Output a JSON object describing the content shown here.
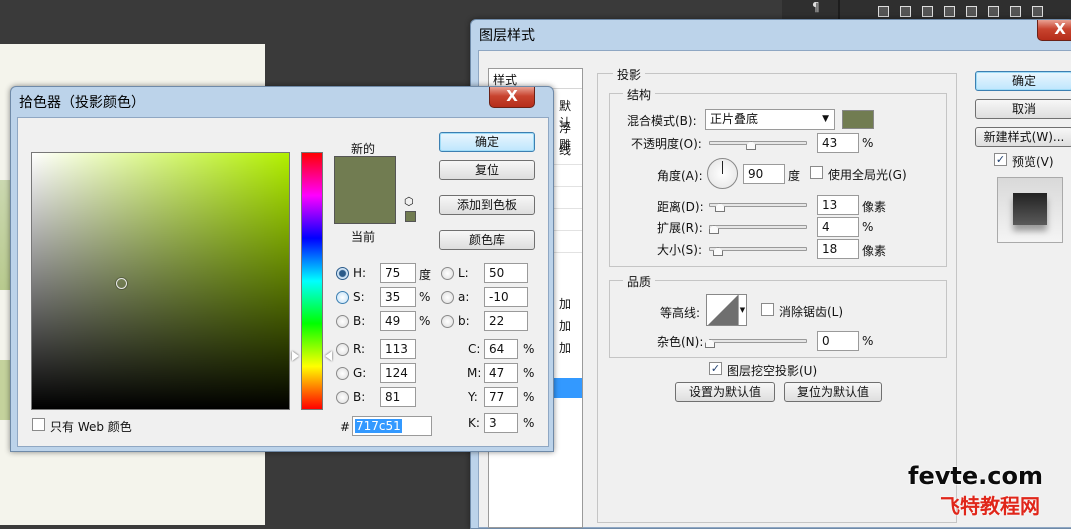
{
  "layer_style": {
    "title": "图层样式",
    "close": "X",
    "styles_header": "样式",
    "styles_partial": [
      "默认",
      "浮雕",
      "线"
    ],
    "styles_partial_lower": [
      "加",
      "加",
      "加"
    ],
    "section_title": "投影",
    "structure": {
      "title": "结构",
      "blend_mode_label": "混合模式(B):",
      "blend_mode_value": "正片叠底",
      "blend_color": "#717c51",
      "opacity_label": "不透明度(O):",
      "opacity_value": "43",
      "opacity_unit": "%",
      "opacity_level": 0.43,
      "angle_label": "角度(A):",
      "angle_value": "90",
      "angle_unit": "度",
      "global_light_label": "使用全局光(G)",
      "global_light_checked": false,
      "distance_label": "距离(D):",
      "distance_value": "13",
      "distance_unit": "像素",
      "spread_label": "扩展(R):",
      "spread_value": "4",
      "spread_unit": "%",
      "size_label": "大小(S):",
      "size_value": "18",
      "size_unit": "像素"
    },
    "quality": {
      "title": "品质",
      "contour_label": "等高线:",
      "antialias_label": "消除锯齿(L)",
      "noise_label": "杂色(N):",
      "noise_value": "0",
      "noise_unit": "%"
    },
    "knockout_label": "图层挖空投影(U)",
    "knockout_checked": true,
    "make_default": "设置为默认值",
    "reset_default": "复位为默认值",
    "ok": "确定",
    "cancel": "取消",
    "new_style": "新建样式(W)...",
    "preview_label": "预览(V)",
    "preview_checked": true
  },
  "color_picker": {
    "title": "拾色器（投影颜色）",
    "close": "X",
    "new_label": "新的",
    "current_label": "当前",
    "new_color": "#717c51",
    "current_color": "#717c51",
    "hue_color": "#b2f000",
    "ok": "确定",
    "reset": "复位",
    "add_swatch": "添加到色板",
    "color_libraries": "颜色库",
    "fields": {
      "H": {
        "label": "H:",
        "value": "75",
        "unit": "度"
      },
      "S": {
        "label": "S:",
        "value": "35",
        "unit": "%"
      },
      "Bv": {
        "label": "B:",
        "value": "49",
        "unit": "%"
      },
      "R": {
        "label": "R:",
        "value": "113"
      },
      "G": {
        "label": "G:",
        "value": "124"
      },
      "Bc": {
        "label": "B:",
        "value": "81"
      },
      "L": {
        "label": "L:",
        "value": "50"
      },
      "a": {
        "label": "a:",
        "value": "-10"
      },
      "b": {
        "label": "b:",
        "value": "22"
      },
      "C": {
        "label": "C:",
        "value": "64",
        "unit": "%"
      },
      "M": {
        "label": "M:",
        "value": "47",
        "unit": "%"
      },
      "Y": {
        "label": "Y:",
        "value": "77",
        "unit": "%"
      },
      "K": {
        "label": "K:",
        "value": "3",
        "unit": "%"
      }
    },
    "hex_label": "#",
    "hex_value": "717c51",
    "web_only_label": "只有 Web 颜色",
    "web_only_checked": false,
    "hue_level": 0.21,
    "marker_saturation": 0.35,
    "marker_brightness": 0.49
  },
  "watermark": {
    "line1": "fevte.com",
    "line2": "飞特教程网"
  }
}
